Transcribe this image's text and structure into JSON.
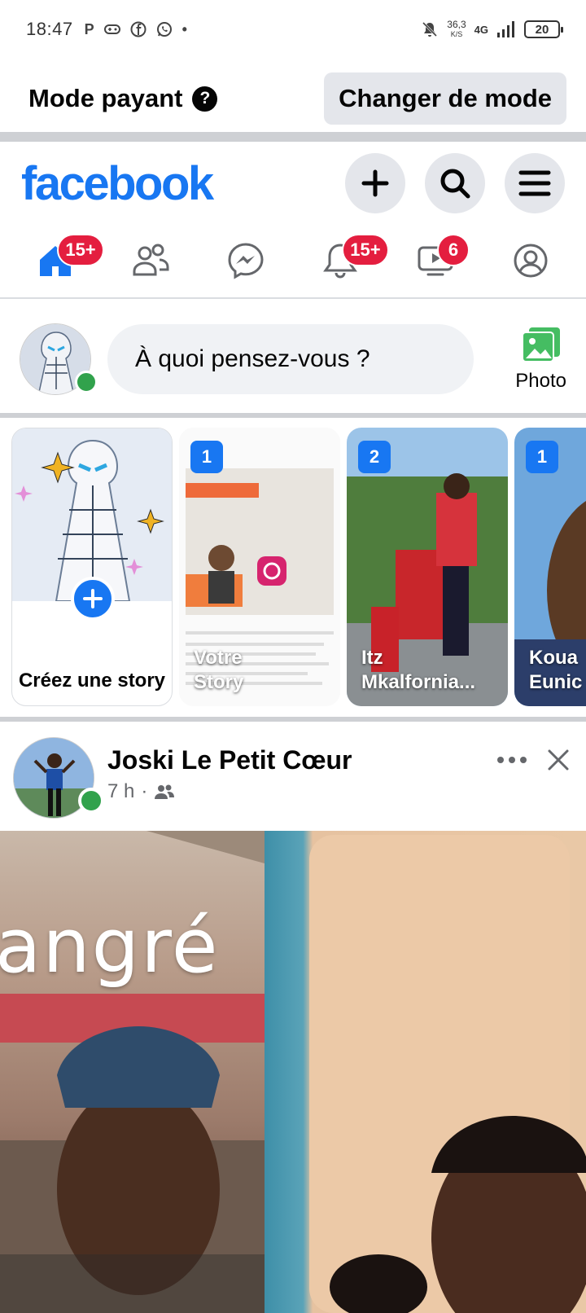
{
  "status_bar": {
    "time": "18:47",
    "icons": [
      "parking-icon",
      "gamepad-icon",
      "facebook-icon",
      "whatsapp-icon",
      "dot-icon"
    ],
    "net_speed_value": "36,3",
    "net_speed_unit": "K/S",
    "network": "4G",
    "battery": "20"
  },
  "mode_bar": {
    "title": "Mode payant",
    "help": "?",
    "change_button": "Changer de mode"
  },
  "header": {
    "logo": "facebook",
    "actions": [
      "plus-icon",
      "search-icon",
      "menu-icon"
    ]
  },
  "nav_tabs": [
    {
      "name": "home",
      "badge": "15+"
    },
    {
      "name": "friends",
      "badge": ""
    },
    {
      "name": "messenger",
      "badge": ""
    },
    {
      "name": "notifications",
      "badge": "15+"
    },
    {
      "name": "video",
      "badge": "6"
    },
    {
      "name": "profile",
      "badge": ""
    }
  ],
  "composer": {
    "placeholder": "À quoi pensez-vous ?",
    "photo_label": "Photo"
  },
  "stories": [
    {
      "type": "create",
      "label": "Créez une story"
    },
    {
      "type": "story",
      "count": "1",
      "name": "Votre Story"
    },
    {
      "type": "story",
      "count": "2",
      "name": "Itz Mkalfornia..."
    },
    {
      "type": "story",
      "count": "1",
      "name": "Koua Eunic"
    }
  ],
  "post": {
    "author": "Joski Le Petit Cœur",
    "time": "7 h",
    "audience_icon": "friends-icon",
    "image_text": "angré"
  },
  "colors": {
    "brand": "#1877f2",
    "badge": "#e41e3f",
    "online": "#31a24c",
    "photo_green": "#45bd62"
  }
}
